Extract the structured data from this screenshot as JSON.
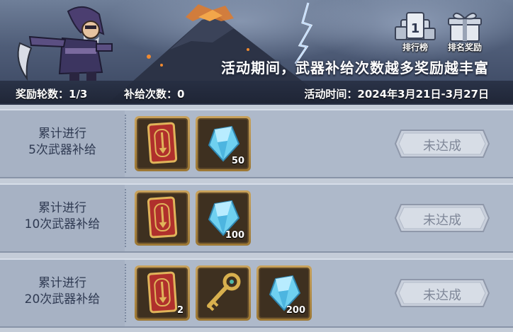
{
  "banner": {
    "title": "活动期间，武器补给次数越多奖励越丰富",
    "round_label": "奖励轮数：1/3",
    "supply_label": "补给次数：0",
    "time_label": "活动时间：2024年3月21日-3月27日"
  },
  "buttons": {
    "rank_label": "排行榜",
    "rank_badge": "1",
    "rank_reward_label": "排名奖励"
  },
  "rows": [
    {
      "condition_line1": "累计进行",
      "condition_line2": "5次武器补给",
      "status": "未达成",
      "items": [
        {
          "icon": "weapon-card-icon",
          "qty": ""
        },
        {
          "icon": "diamond-icon",
          "qty": "50"
        }
      ]
    },
    {
      "condition_line1": "累计进行",
      "condition_line2": "10次武器补给",
      "status": "未达成",
      "items": [
        {
          "icon": "weapon-card-icon",
          "qty": ""
        },
        {
          "icon": "diamond-icon",
          "qty": "100"
        }
      ]
    },
    {
      "condition_line1": "累计进行",
      "condition_line2": "20次武器补给",
      "status": "未达成",
      "items": [
        {
          "icon": "weapon-card-icon",
          "qty": "2"
        },
        {
          "icon": "key-icon",
          "qty": ""
        },
        {
          "icon": "diamond-icon",
          "qty": "200"
        }
      ]
    }
  ],
  "colors": {
    "banner_bg": "#4f5d78",
    "row_bg": "#aeb9ca",
    "item_frame": "#c8a25c",
    "diamond": "#6fd0f0",
    "card_red": "#b0302c"
  }
}
